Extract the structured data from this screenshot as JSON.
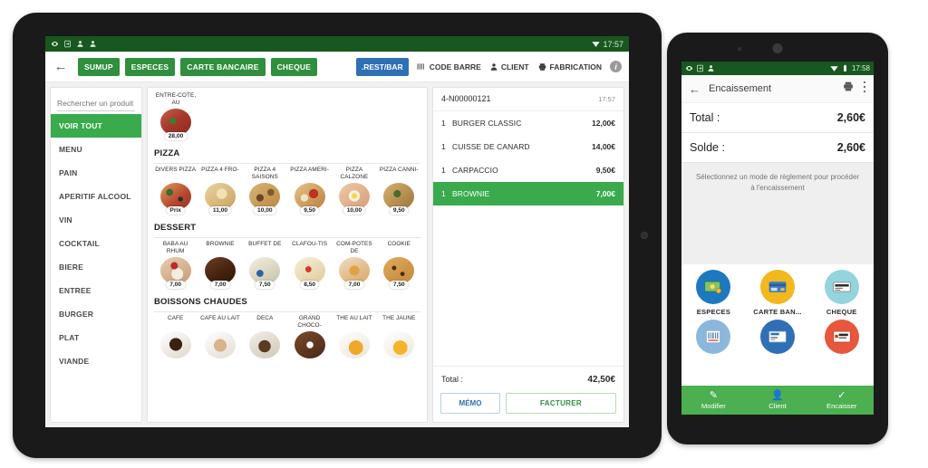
{
  "tablet": {
    "status_bar": {
      "time": "17:57",
      "icons": [
        "eye-icon",
        "sync-icon",
        "user-icon",
        "user-icon"
      ],
      "wifi_icon": "wifi-icon"
    },
    "toolbar": {
      "back_icon": "back-arrow-icon",
      "payment_buttons": [
        "SUMUP",
        "ESPECES",
        "CARTE BANCAIRE",
        "CHEQUE"
      ],
      "rest_bar_label": ".REST/BAR",
      "code_barre_label": "CODE BARRE",
      "client_label": "CLIENT",
      "fabrication_label": "FABRICATION",
      "info_label": "i"
    },
    "search": {
      "placeholder": "Rechercher un produit",
      "value": ""
    },
    "categories": [
      {
        "label": "VOIR TOUT",
        "active": true
      },
      {
        "label": "MENU",
        "active": false
      },
      {
        "label": "PAIN",
        "active": false
      },
      {
        "label": "APERITIF ALCOOL",
        "active": false
      },
      {
        "label": "VIN",
        "active": false
      },
      {
        "label": "COCKTAIL",
        "active": false
      },
      {
        "label": "BIERE",
        "active": false
      },
      {
        "label": "ENTREE",
        "active": false
      },
      {
        "label": "BURGER",
        "active": false
      },
      {
        "label": "PLAT",
        "active": false
      },
      {
        "label": "VIANDE",
        "active": false
      }
    ],
    "product_sections": [
      {
        "title": "",
        "items": [
          {
            "name": "ENTRE-COTE, AU",
            "price": "28,00",
            "img": "img-entrecote"
          }
        ]
      },
      {
        "title": "PIZZA",
        "items": [
          {
            "name": "DIVERS PIZZA",
            "price": "Prix",
            "img": "img-pz-divers"
          },
          {
            "name": "PIZZA 4 FRO-",
            "price": "11,00",
            "img": "img-pz-4fro"
          },
          {
            "name": "PIZZA 4 SAISONS",
            "price": "10,00",
            "img": "img-pz-4sais"
          },
          {
            "name": "PIZZA AMERI-",
            "price": "9,50",
            "img": "img-pz-ameri"
          },
          {
            "name": "PIZZA CALZONE",
            "price": "10,00",
            "img": "img-pz-calz"
          },
          {
            "name": "PIZZA CANNI-",
            "price": "9,50",
            "img": "img-pz-canni"
          }
        ]
      },
      {
        "title": "DESSERT",
        "items": [
          {
            "name": "BABA AU RHUM",
            "price": "7,00",
            "img": "img-baba"
          },
          {
            "name": "BROWNIE",
            "price": "7,00",
            "img": "img-brownie"
          },
          {
            "name": "BUFFET DE",
            "price": "7,50",
            "img": "img-buffet"
          },
          {
            "name": "CLAFOU-TIS",
            "price": "8,50",
            "img": "img-clafoutis"
          },
          {
            "name": "COM-POTES DE",
            "price": "7,00",
            "img": "img-compote"
          },
          {
            "name": "COOKIE",
            "price": "7,50",
            "img": "img-cookie"
          }
        ]
      },
      {
        "title": "BOISSONS CHAUDES",
        "items": [
          {
            "name": "CAFE",
            "price": "",
            "img": "img-cafe"
          },
          {
            "name": "CAFE AU LAIT",
            "price": "",
            "img": "img-cafelait"
          },
          {
            "name": "DECA",
            "price": "",
            "img": "img-deca"
          },
          {
            "name": "GRAND CHOCO-",
            "price": "",
            "img": "img-choco"
          },
          {
            "name": "THE AU LAIT",
            "price": "",
            "img": "img-thelait"
          },
          {
            "name": "THE JAUNE",
            "price": "",
            "img": "img-thejaune"
          }
        ]
      }
    ],
    "ticket": {
      "number": "4-N00000121",
      "time": "17:57",
      "lines": [
        {
          "qty": "1",
          "name": "BURGER CLASSIC",
          "amount": "12,00€",
          "selected": false
        },
        {
          "qty": "1",
          "name": "CUISSE DE CANARD",
          "amount": "14,00€",
          "selected": false
        },
        {
          "qty": "1",
          "name": "CARPACCIO",
          "amount": "9,50€",
          "selected": false
        },
        {
          "qty": "1",
          "name": "BROWNIE",
          "amount": "7,00€",
          "selected": true
        }
      ],
      "total_label": "Total :",
      "total_value": "42,50€",
      "memo_label": "MÉMO",
      "facturer_label": "FACTURER"
    }
  },
  "phone": {
    "status_bar": {
      "time": "17:58",
      "icons": [
        "eye-icon",
        "sync-icon",
        "user-icon"
      ],
      "wifi_icon": "wifi-icon",
      "battery_icon": "battery-icon"
    },
    "app_bar": {
      "back_icon": "back-arrow-icon",
      "title": "Encaissement",
      "print_icon": "printer-icon",
      "overflow_icon": "more-vert-icon"
    },
    "total_label": "Total :",
    "total_value": "2,60€",
    "solde_label": "Solde :",
    "solde_value": "2,60€",
    "hint": "Sélectionnez un mode de règlement pour procéder à l'encaissement",
    "payment_methods_row1": [
      {
        "label": "ESPECES",
        "color": "#1d78c1",
        "icon": "cash-icon"
      },
      {
        "label": "CARTE BAN...",
        "color": "#f2b81e",
        "icon": "credit-card-icon"
      },
      {
        "label": "CHEQUE",
        "color": "#93d4de",
        "icon": "cheque-icon"
      }
    ],
    "payment_methods_row2": [
      {
        "label": "",
        "color": "#8cb7dd",
        "icon": "receipt-icon"
      },
      {
        "label": "",
        "color": "#2f6fb5",
        "icon": "amex-card-icon"
      },
      {
        "label": "",
        "color": "#e8563b",
        "icon": "ticket-restaurant-icon"
      }
    ],
    "bottom_nav": [
      {
        "label": "Modifier",
        "icon": "pencil-icon"
      },
      {
        "label": "Client",
        "icon": "person-icon"
      },
      {
        "label": "Encaisser",
        "icon": "check-icon"
      }
    ]
  },
  "colors": {
    "green_primary": "#2f8f3e",
    "green_accent": "#3aab4c",
    "green_status": "#18571f",
    "blue_accent": "#2f6fb5",
    "nav_green": "#4caf50"
  }
}
